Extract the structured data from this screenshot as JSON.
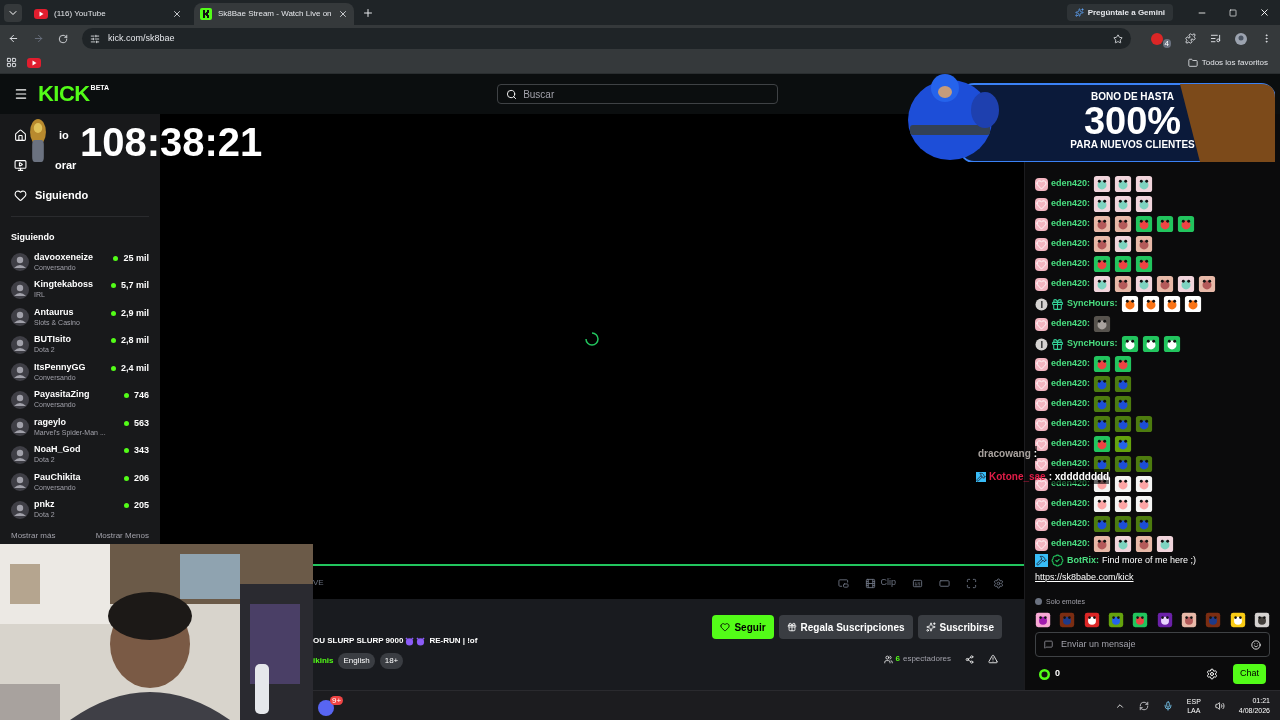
{
  "browser": {
    "tabs": [
      {
        "title": "(116) YouTube",
        "kind": "youtube",
        "selected": false
      },
      {
        "title": "Sk8Bae Stream - Watch Live on",
        "kind": "kick",
        "selected": true
      }
    ],
    "gemini_button": "Pregúntale a Gemini",
    "address": "kick.com/sk8bae",
    "extension_badge": "4",
    "bookmarks_folder": "Todos los favoritos"
  },
  "header": {
    "logo": "KICK",
    "logo_tag": "BETA",
    "search_placeholder": "Buscar"
  },
  "overlay": {
    "timer": "108:38:21",
    "ad": {
      "line_1": "BONO DE HASTA",
      "line_2": "300%",
      "line_3": "PARA NUEVOS CLIENTES"
    },
    "stream_chat": [
      {
        "user": "dracowang",
        "text": ":",
        "color": "#a8a29e",
        "badge": false
      },
      {
        "user": "Kotone_sae",
        "text": ": xdddddddd",
        "color": "#e11d48",
        "badge": true
      }
    ]
  },
  "sidebar": {
    "nav": [
      {
        "label": "io",
        "kind": "home"
      },
      {
        "label": "orar",
        "kind": "browse"
      },
      {
        "label": "Siguiendo",
        "kind": "following"
      }
    ],
    "section_title": "Siguiendo",
    "channels": [
      {
        "name": "davooxeneize",
        "category": "Conversando",
        "viewers": "25 mil"
      },
      {
        "name": "Kingtekaboss",
        "category": "IRL",
        "viewers": "5,7 mil"
      },
      {
        "name": "Antaurus",
        "category": "Slots & Casino",
        "viewers": "2,9 mil"
      },
      {
        "name": "BUTIsito",
        "category": "Dota 2",
        "viewers": "2,8 mil"
      },
      {
        "name": "ItsPennyGG",
        "category": "Conversando",
        "viewers": "2,4 mil"
      },
      {
        "name": "PayasitaZing",
        "category": "Conversando",
        "viewers": "746"
      },
      {
        "name": "rageylo",
        "category": "Marvel's Spider-Man ...",
        "viewers": "563"
      },
      {
        "name": "NoaH_God",
        "category": "Dota 2",
        "viewers": "343"
      },
      {
        "name": "PauChikita",
        "category": "Conversando",
        "viewers": "206"
      },
      {
        "name": "pnkz",
        "category": "Dota 2",
        "viewers": "205"
      }
    ],
    "show_more": "Mostrar más",
    "show_less": "Mostrar Menos"
  },
  "player": {
    "progress": {
      "level": 1
    },
    "live_label": "VE",
    "clip_label": "Clip"
  },
  "stream": {
    "title_start": "OU SLURP SLURP 9000",
    "title_end": "RE-RUN | !of",
    "category": "ikinis",
    "tags": [
      "English",
      "18+"
    ],
    "follow_button": "Seguir",
    "gift_button": "Regala Suscripciones",
    "subscribe_button": "Suscribirse",
    "viewers_count": "6",
    "viewers_label": "espectadores"
  },
  "chat": {
    "messages": [
      {
        "user": "eden420:",
        "badges": [
          {
            "kind": "heart"
          }
        ],
        "emotes": [
          {
            "kind": "cat"
          },
          {
            "kind": "cat"
          },
          {
            "kind": "cat"
          }
        ]
      },
      {
        "user": "eden420:",
        "badges": [
          {
            "kind": "heart"
          }
        ],
        "emotes": [
          {
            "kind": "cat"
          },
          {
            "kind": "cat"
          },
          {
            "kind": "cat"
          }
        ]
      },
      {
        "user": "eden420:",
        "badges": [
          {
            "kind": "heart"
          }
        ],
        "emotes": [
          {
            "kind": "leg"
          },
          {
            "kind": "leg"
          },
          {
            "kind": "blob"
          },
          {
            "kind": "blob"
          },
          {
            "kind": "blob"
          }
        ]
      },
      {
        "user": "eden420:",
        "badges": [
          {
            "kind": "heart"
          }
        ],
        "emotes": [
          {
            "kind": "leg"
          },
          {
            "kind": "cat"
          },
          {
            "kind": "leg"
          }
        ]
      },
      {
        "user": "eden420:",
        "badges": [
          {
            "kind": "heart"
          }
        ],
        "emotes": [
          {
            "kind": "blob"
          },
          {
            "kind": "blob"
          },
          {
            "kind": "blob"
          }
        ]
      },
      {
        "user": "eden420:",
        "badges": [
          {
            "kind": "heart"
          }
        ],
        "emotes": [
          {
            "kind": "cat"
          },
          {
            "kind": "leg"
          },
          {
            "kind": "cat"
          },
          {
            "kind": "leg"
          },
          {
            "kind": "cat"
          },
          {
            "kind": "leg"
          }
        ]
      },
      {
        "user": "SyncHours:",
        "badges": [
          {
            "kind": "one"
          },
          {
            "kind": "gift"
          }
        ],
        "emotes": [
          {
            "kind": "pepper"
          },
          {
            "kind": "pepper"
          },
          {
            "kind": "pepper"
          },
          {
            "kind": "pepper"
          }
        ]
      },
      {
        "user": "eden420:",
        "badges": [
          {
            "kind": "heart"
          }
        ],
        "emotes": [
          {
            "kind": "rat"
          }
        ]
      },
      {
        "user": "SyncHours:",
        "badges": [
          {
            "kind": "one"
          },
          {
            "kind": "gift"
          }
        ],
        "emotes": [
          {
            "kind": "smile"
          },
          {
            "kind": "smile"
          },
          {
            "kind": "smile"
          }
        ]
      },
      {
        "user": "eden420:",
        "badges": [
          {
            "kind": "heart"
          }
        ],
        "emotes": [
          {
            "kind": "blob"
          },
          {
            "kind": "blob"
          }
        ]
      },
      {
        "user": "eden420:",
        "badges": [
          {
            "kind": "heart"
          }
        ],
        "emotes": [
          {
            "kind": "pepe"
          },
          {
            "kind": "pepe"
          }
        ]
      },
      {
        "user": "eden420:",
        "badges": [
          {
            "kind": "heart"
          }
        ],
        "emotes": [
          {
            "kind": "pepe"
          },
          {
            "kind": "pepe"
          }
        ]
      },
      {
        "user": "eden420:",
        "badges": [
          {
            "kind": "heart"
          }
        ],
        "emotes": [
          {
            "kind": "pepe"
          },
          {
            "kind": "pepe"
          },
          {
            "kind": "pepe"
          }
        ]
      },
      {
        "user": "eden420:",
        "badges": [
          {
            "kind": "heart"
          }
        ],
        "emotes": [
          {
            "kind": "blob"
          },
          {
            "kind": "frog"
          }
        ]
      },
      {
        "user": "eden420:",
        "badges": [
          {
            "kind": "heart"
          }
        ],
        "emotes": [
          {
            "kind": "pepe"
          },
          {
            "kind": "pepe"
          },
          {
            "kind": "pepe"
          }
        ]
      },
      {
        "user": "eden420:",
        "badges": [
          {
            "kind": "heart"
          }
        ],
        "emotes": [
          {
            "kind": "baby"
          },
          {
            "kind": "baby"
          },
          {
            "kind": "baby"
          }
        ]
      },
      {
        "user": "eden420:",
        "badges": [
          {
            "kind": "heart"
          }
        ],
        "emotes": [
          {
            "kind": "baby"
          },
          {
            "kind": "baby"
          },
          {
            "kind": "baby"
          }
        ]
      },
      {
        "user": "eden420:",
        "badges": [
          {
            "kind": "heart"
          }
        ],
        "emotes": [
          {
            "kind": "pepe"
          },
          {
            "kind": "pepe"
          },
          {
            "kind": "pepe"
          }
        ]
      },
      {
        "user": "eden420:",
        "badges": [
          {
            "kind": "heart"
          }
        ],
        "emotes": [
          {
            "kind": "leg"
          },
          {
            "kind": "cat"
          },
          {
            "kind": "leg"
          },
          {
            "kind": "cat"
          }
        ]
      },
      {
        "user": "BotRix:",
        "badges": [
          {
            "kind": "hammer"
          },
          {
            "kind": "verified"
          }
        ],
        "text": "Find more of me here ;)",
        "link": "https://sk8babe.com/kick"
      }
    ],
    "emote_only_label": "Solo emotes",
    "emote_bar": [
      {
        "kind": "pink"
      },
      {
        "kind": "face"
      },
      {
        "kind": "flag"
      },
      {
        "kind": "frog"
      },
      {
        "kind": "blob"
      },
      {
        "kind": "purple"
      },
      {
        "kind": "leg"
      },
      {
        "kind": "face"
      },
      {
        "kind": "bird"
      },
      {
        "kind": "gray"
      }
    ],
    "input_placeholder": "Enviar un mensaje",
    "points": "0",
    "send_button": "Chat"
  },
  "taskbar": {
    "discord_badge": "9+",
    "language": "ESP",
    "layout": "LAA",
    "time": "01:21",
    "date": "4/08/2026"
  }
}
